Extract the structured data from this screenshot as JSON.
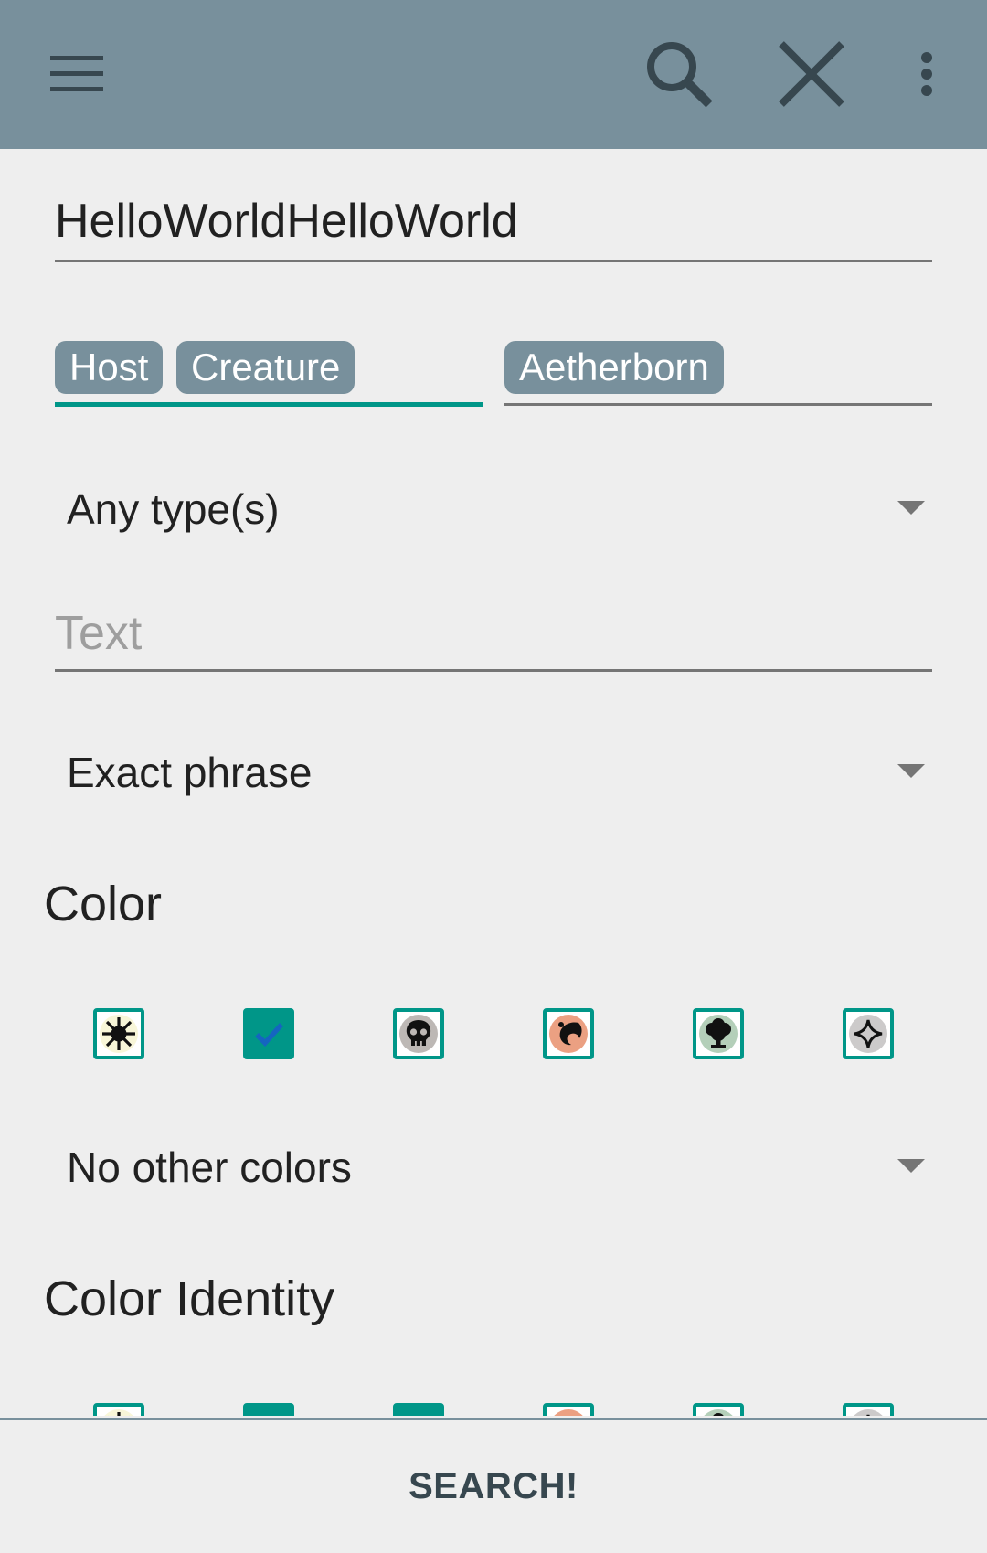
{
  "toolbar": {
    "icons": [
      "menu-icon",
      "search-icon",
      "close-icon",
      "more-vert-icon"
    ],
    "background": "#78909c"
  },
  "form": {
    "name_value": "HelloWorldHelloWorld",
    "supertypes": [
      "Host",
      "Creature"
    ],
    "subtypes": [
      "Aetherborn"
    ],
    "type_spinner": "Any type(s)",
    "text_placeholder": "Text",
    "text_spinner": "Exact phrase",
    "color_title": "Color",
    "colors": [
      {
        "name": "white",
        "icon": "white-mana-icon",
        "checked": false
      },
      {
        "name": "blue",
        "icon": "blue-mana-icon",
        "checked": true
      },
      {
        "name": "black",
        "icon": "black-mana-icon",
        "checked": false
      },
      {
        "name": "red",
        "icon": "red-mana-icon",
        "checked": false
      },
      {
        "name": "green",
        "icon": "green-mana-icon",
        "checked": false
      },
      {
        "name": "colorless",
        "icon": "colorless-mana-icon",
        "checked": false
      }
    ],
    "color_spinner": "No other colors",
    "color_identity_title": "Color Identity",
    "color_identity": [
      {
        "name": "white",
        "icon": "white-mana-icon",
        "checked": false
      },
      {
        "name": "blue",
        "icon": "blue-mana-icon",
        "checked": true
      },
      {
        "name": "black",
        "icon": "black-mana-icon",
        "checked": true
      },
      {
        "name": "red",
        "icon": "red-mana-icon",
        "checked": false
      },
      {
        "name": "green",
        "icon": "green-mana-icon",
        "checked": false
      },
      {
        "name": "colorless",
        "icon": "colorless-mana-icon",
        "checked": false
      }
    ]
  },
  "search_button": "SEARCH!",
  "colors": {
    "accent": "#009688",
    "primary": "#78909c",
    "background": "#eeeeee"
  }
}
